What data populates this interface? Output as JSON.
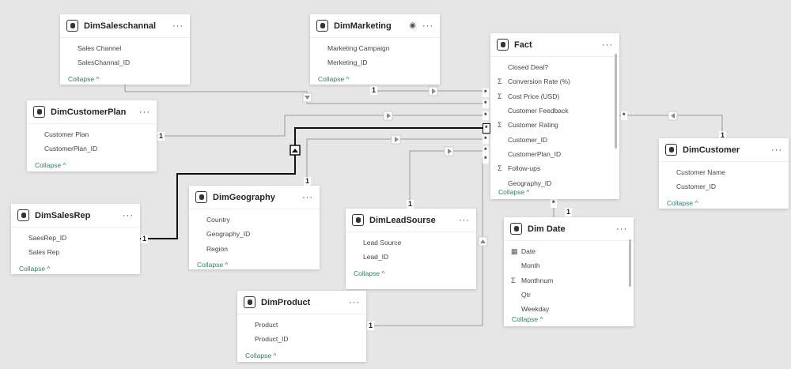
{
  "tables": [
    {
      "id": "saleschannel",
      "name": "DimSaleschannal",
      "fields": [
        {
          "label": "Sales Channel"
        },
        {
          "label": "SalesChannal_ID"
        }
      ]
    },
    {
      "id": "marketing",
      "name": "DimMarketing",
      "fields": [
        {
          "label": "Marketing Campaign"
        },
        {
          "label": "Merketing_ID"
        }
      ]
    },
    {
      "id": "fact",
      "name": "Fact",
      "fields": [
        {
          "label": "Closed Deal?",
          "icon": ""
        },
        {
          "label": "Conversion Rate (%)",
          "icon": "Σ"
        },
        {
          "label": "Cost Price (USD)",
          "icon": "Σ"
        },
        {
          "label": "Customer Feedback",
          "icon": ""
        },
        {
          "label": "Customer Rating",
          "icon": "Σ"
        },
        {
          "label": "Customer_ID",
          "icon": ""
        },
        {
          "label": "CustomerPlan_ID",
          "icon": ""
        },
        {
          "label": "Follow-ups",
          "icon": "Σ"
        },
        {
          "label": "Geography_ID",
          "icon": ""
        }
      ]
    },
    {
      "id": "customerplan",
      "name": "DimCustomerPlan",
      "fields": [
        {
          "label": "Customer Plan"
        },
        {
          "label": "CustomerPlan_ID"
        }
      ]
    },
    {
      "id": "customer",
      "name": "DimCustomer",
      "fields": [
        {
          "label": "Customer Name"
        },
        {
          "label": "Customer_ID"
        }
      ]
    },
    {
      "id": "salesrep",
      "name": "DimSalesRep",
      "fields": [
        {
          "label": "SaesRep_ID"
        },
        {
          "label": "Sales Rep"
        }
      ]
    },
    {
      "id": "geography",
      "name": "DimGeography",
      "fields": [
        {
          "label": "Country"
        },
        {
          "label": "Geography_ID"
        },
        {
          "label": "Region"
        }
      ]
    },
    {
      "id": "leadsource",
      "name": "DimLeadSourse",
      "fields": [
        {
          "label": "Lead Source"
        },
        {
          "label": "Lead_ID"
        }
      ]
    },
    {
      "id": "date",
      "name": "Dim Date",
      "fields": [
        {
          "label": "Date",
          "icon": "▦"
        },
        {
          "label": "Month",
          "icon": ""
        },
        {
          "label": "Monthnum",
          "icon": "Σ"
        },
        {
          "label": "Qtr",
          "icon": ""
        },
        {
          "label": "Weekday",
          "icon": ""
        }
      ]
    },
    {
      "id": "product",
      "name": "DimProduct",
      "fields": [
        {
          "label": "Product"
        },
        {
          "label": "Product_ID"
        }
      ]
    }
  ],
  "collapse_label": "Collapse ^",
  "more_label": "···",
  "cardinality": {
    "one": "1",
    "many": "*"
  }
}
